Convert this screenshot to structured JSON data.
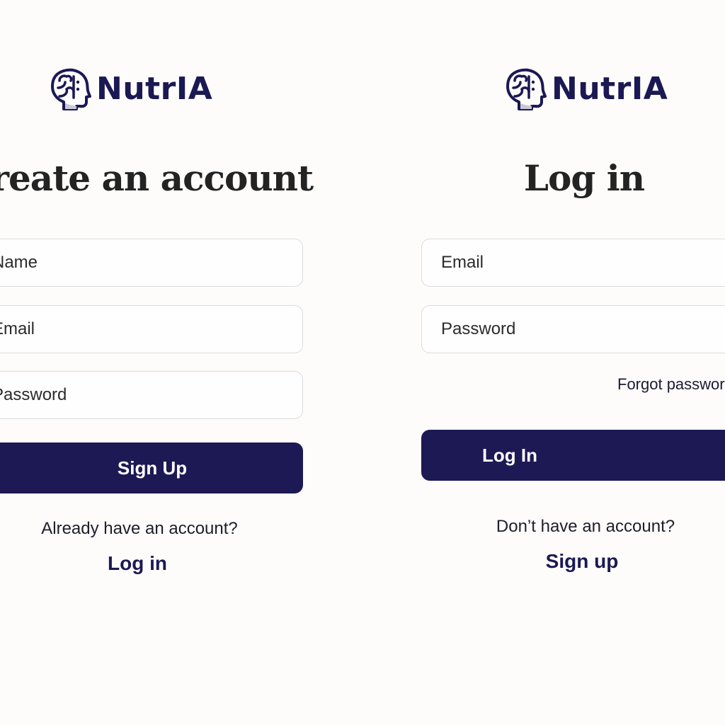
{
  "brand": {
    "name": "NutrIA",
    "color": "#1b1953",
    "logo_icon": "head-brain-icon"
  },
  "signup": {
    "title": "Create an account",
    "name_placeholder": "Name",
    "email_placeholder": "Email",
    "password_placeholder": "Password",
    "submit_label": "Sign Up",
    "switch_prompt": "Already have an account?",
    "switch_link": "Log in"
  },
  "login": {
    "title": "Log in",
    "email_placeholder": "Email",
    "password_placeholder": "Password",
    "forgot_label": "Forgot password?",
    "submit_label": "Log In",
    "switch_prompt": "Don’t have an account?",
    "switch_link": "Sign up"
  },
  "colors": {
    "primary_button": "#1c1954",
    "background": "#fdfcfb",
    "field_border": "#dcdcdc"
  }
}
